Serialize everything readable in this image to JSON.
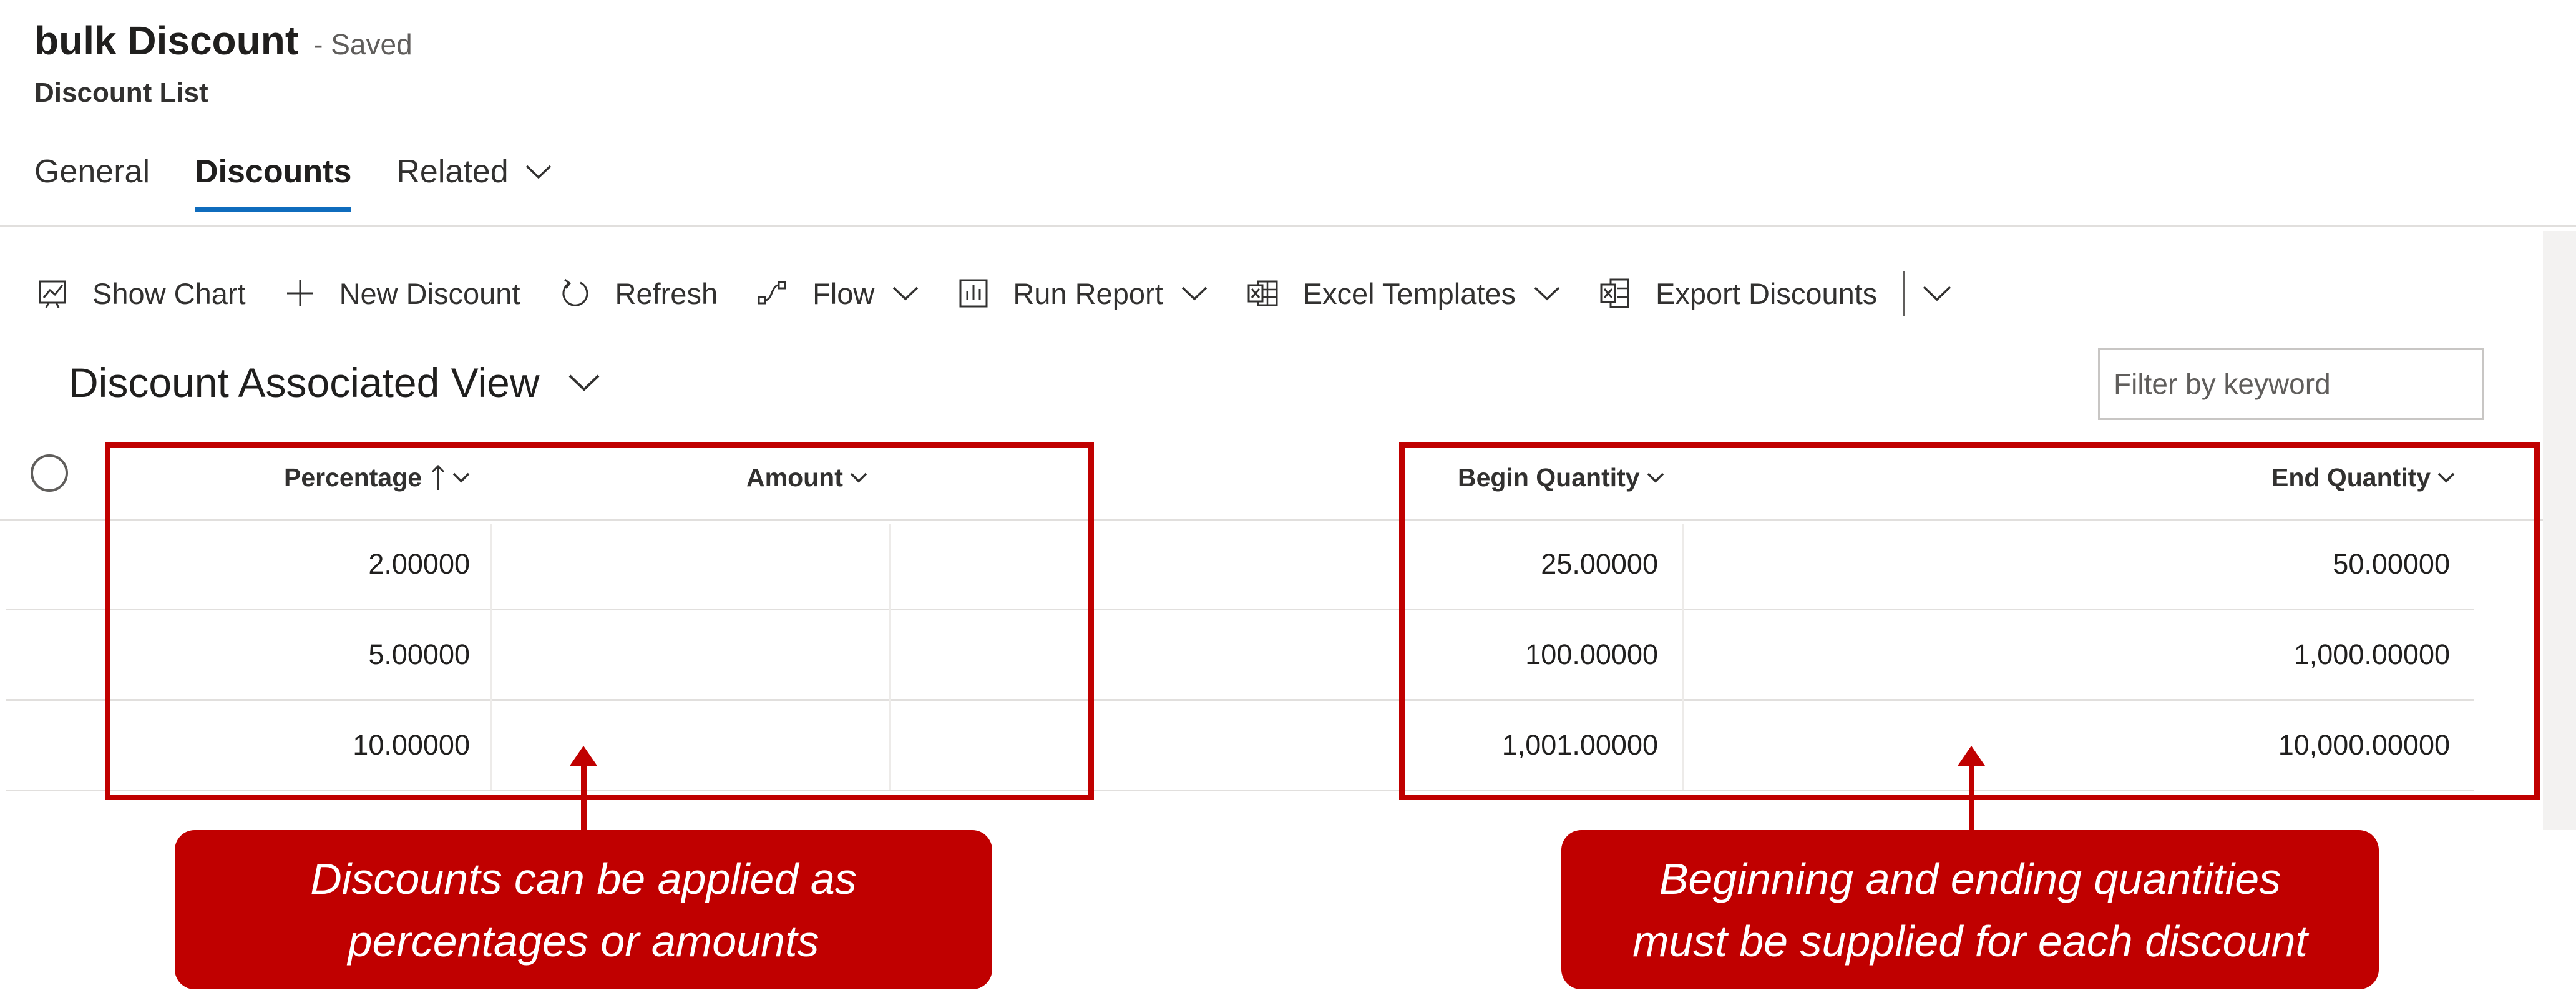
{
  "header": {
    "title": "bulk Discount",
    "saved_state": "- Saved",
    "entity": "Discount List"
  },
  "tabs": [
    {
      "label": "General",
      "active": false
    },
    {
      "label": "Discounts",
      "active": true
    },
    {
      "label": "Related",
      "active": false,
      "has_dropdown": true
    }
  ],
  "command_bar": {
    "show_chart": "Show Chart",
    "new_discount": "New Discount",
    "refresh": "Refresh",
    "flow": "Flow",
    "run_report": "Run Report",
    "excel_templates": "Excel Templates",
    "export_discounts": "Export Discounts"
  },
  "view": {
    "name": "Discount Associated View",
    "filter_placeholder": "Filter by keyword"
  },
  "grid": {
    "columns": {
      "percentage": "Percentage",
      "amount": "Amount",
      "begin_quantity": "Begin Quantity",
      "end_quantity": "End Quantity"
    },
    "rows": [
      {
        "percentage": "2.00000",
        "amount": "",
        "begin_quantity": "25.00000",
        "end_quantity": "50.00000"
      },
      {
        "percentage": "5.00000",
        "amount": "",
        "begin_quantity": "100.00000",
        "end_quantity": "1,000.00000"
      },
      {
        "percentage": "10.00000",
        "amount": "",
        "begin_quantity": "1,001.00000",
        "end_quantity": "10,000.00000"
      }
    ]
  },
  "callouts": {
    "left": {
      "line1": "Discounts can be applied as",
      "line2": "percentages or amounts"
    },
    "right": {
      "line1": "Beginning and ending quantities",
      "line2": "must be supplied for each discount"
    }
  },
  "colors": {
    "accent": "#0f6cbd",
    "callout_red": "#c00000"
  }
}
